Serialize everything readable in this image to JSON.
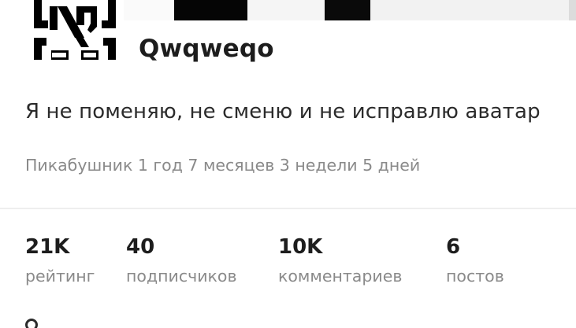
{
  "profile": {
    "username": "Qwqweqo",
    "bio": "Я не поменяю, не сменю и не исправлю аватар",
    "tenure": "Пикабушник 1 год 7 месяцев 3 недели 5 дней"
  },
  "stats": [
    {
      "value": "21K",
      "label": "рейтинг"
    },
    {
      "value": "40",
      "label": "подписчиков"
    },
    {
      "value": "10K",
      "label": "комментариев"
    },
    {
      "value": "6",
      "label": "постов"
    }
  ],
  "icons": {
    "avatar": "rammstein-logo-icon"
  },
  "colors": {
    "text_primary": "#1d1d1d",
    "text_secondary": "#8a8a8a",
    "divider": "#eeeeee"
  }
}
